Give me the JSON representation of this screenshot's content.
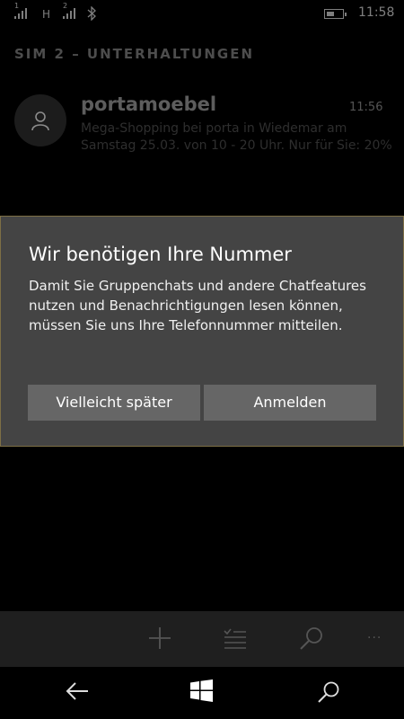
{
  "status_bar": {
    "network_type": "H",
    "sim1_label": "1",
    "sim2_label": "2",
    "battery_level": 0.5,
    "time": "11:58"
  },
  "header": {
    "title": "SIM 2 – UNTERHALTUNGEN"
  },
  "conversations": [
    {
      "name": "portamoebel",
      "time": "11:56",
      "preview_line1": "Mega-Shopping bei porta in Wiedemar am",
      "preview_line2": "Samstag 25.03. von 10 - 20 Uhr. Nur für Sie: 20%"
    }
  ],
  "dialog": {
    "title": "Wir benötigen Ihre Nummer",
    "body": "Damit Sie Gruppenchats und andere Chatfeatures nutzen und Benachrichtigungen lesen können, müssen Sie uns Ihre Telefonnummer mitteilen.",
    "later_label": "Vielleicht später",
    "login_label": "Anmelden",
    "border_color": "#7d6f45"
  },
  "app_bar": {
    "icons": [
      "add-icon",
      "select-icon",
      "search-icon",
      "more-icon"
    ],
    "more_glyph": "···"
  },
  "nav_bar": {
    "icons": [
      "back-icon",
      "windows-icon",
      "search-icon"
    ]
  }
}
